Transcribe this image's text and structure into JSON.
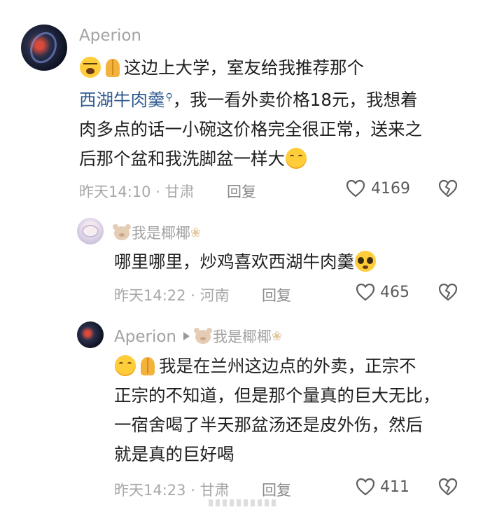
{
  "comments": [
    {
      "username": "Aperion",
      "text_segments": [
        "这边上大学，室友给我推荐那个",
        "西湖牛肉羹",
        "，我一看外卖价格18元，我想着",
        "肉多点的话一小碗这价格完全很正常，送来之",
        "后那个盆和我洗脚盆一样大"
      ],
      "time": "昨天14:10",
      "location": "甘肃",
      "reply_label": "回复",
      "likes": "4169",
      "emojis": [
        "crying-face",
        "folded-hands",
        "smiling-face"
      ]
    },
    {
      "username": "我是椰椰",
      "text": "哪里哪里，炒鸡喜欢西湖牛肉羹",
      "time": "昨天14:22",
      "location": "河南",
      "reply_label": "回复",
      "likes": "465",
      "emojis": [
        "pleading-face"
      ]
    },
    {
      "username": "Aperion",
      "reply_to": "我是椰椰",
      "text_lines": [
        "我是在兰州这边点的外卖，正宗不",
        "正宗的不知道，但是那个量真的巨大无比，",
        "一宿舍喝了半天那盆汤还是皮外伤，然后",
        "就是真的巨好喝"
      ],
      "time": "昨天14:23",
      "location": "甘肃",
      "reply_label": "回复",
      "likes": "411",
      "emojis": [
        "smiling-face",
        "folded-hands"
      ]
    }
  ],
  "separator": "·",
  "colors": {
    "link": "#2f5b8f",
    "meta": "#a8a8a8",
    "text": "#1f1f1f"
  }
}
